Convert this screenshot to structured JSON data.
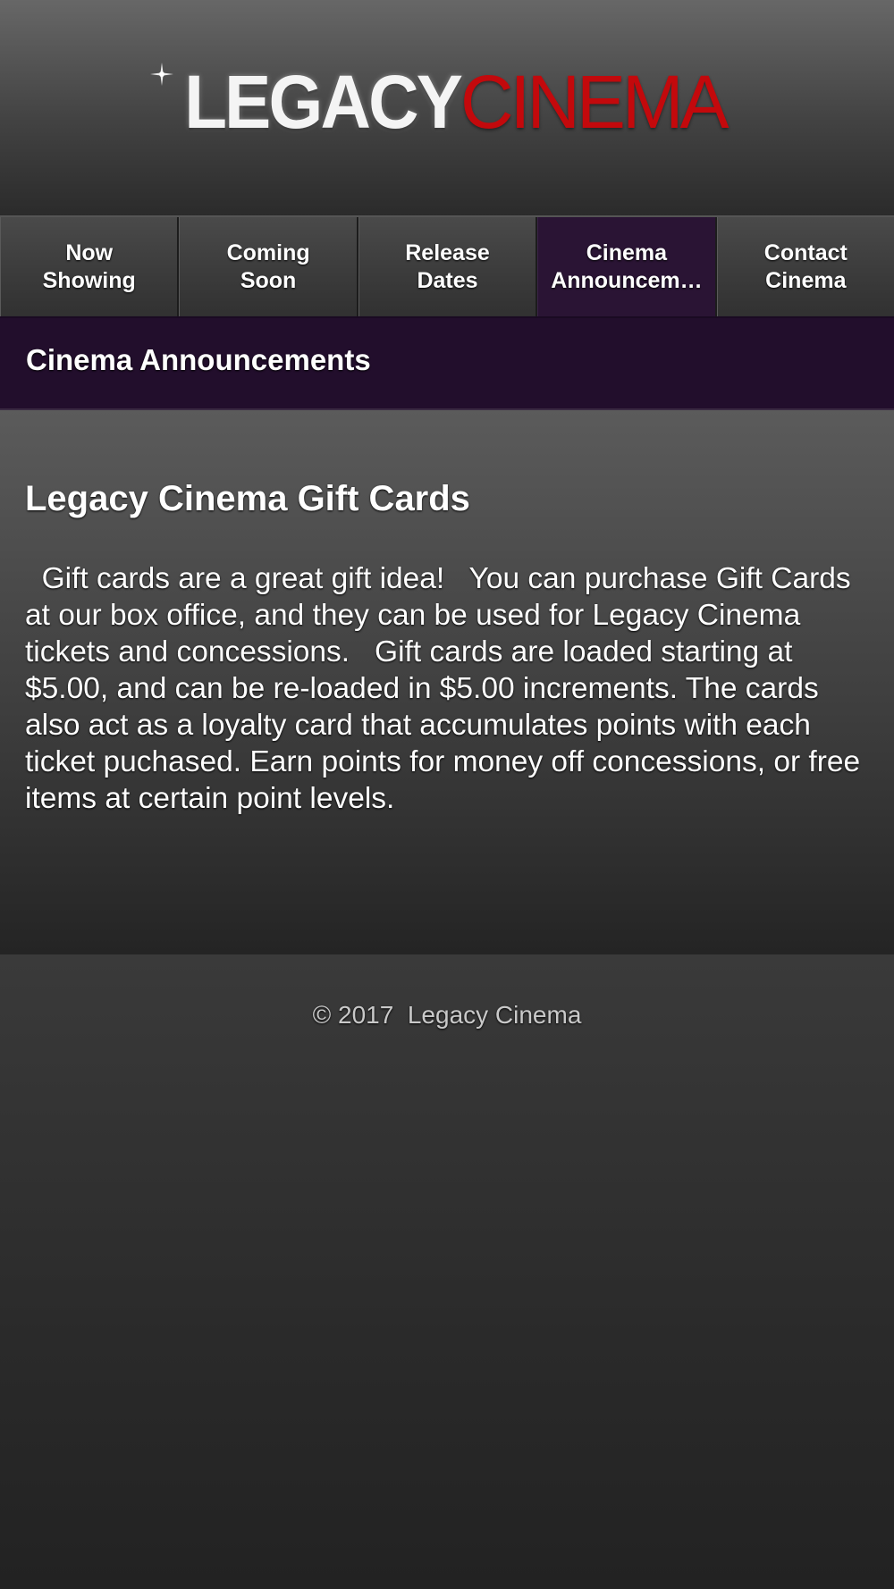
{
  "header": {
    "logo_part1": "LEGACY",
    "logo_part2": "CINEMA",
    "logo_part1_color": "#f4f4f4",
    "logo_part2_color": "#c3090c"
  },
  "nav": {
    "items": [
      {
        "label": "Now\nShowing",
        "active": false
      },
      {
        "label": "Coming\nSoon",
        "active": false
      },
      {
        "label": "Release\nDates",
        "active": false
      },
      {
        "label": "Cinema\nAnnouncem…",
        "active": true
      },
      {
        "label": "Contact\nCinema",
        "active": false
      }
    ],
    "active_color": "#2a1434"
  },
  "section": {
    "title": "Cinema Announcements",
    "bar_color": "#220e2c"
  },
  "article": {
    "title": "Legacy Cinema Gift Cards",
    "body": "  Gift cards are a great gift idea!   You can purchase Gift Cards at our box office, and they can be used for Legacy Cinema tickets and concessions.   Gift cards are loaded starting at $5.00, and can be re-loaded in $5.00 increments. The cards also act as a loyalty card that accumulates points with each ticket puchased. Earn points for money off concessions, or free items at certain point levels."
  },
  "footer": {
    "copyright": "© 2017  Legacy Cinema"
  }
}
